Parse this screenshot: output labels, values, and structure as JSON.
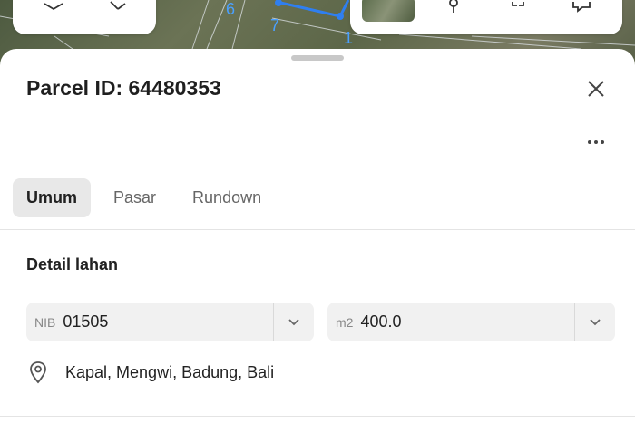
{
  "map": {
    "parcel_numbers": [
      "6",
      "7",
      "1"
    ],
    "accent_color": "#2f7ff0"
  },
  "toolbar_left": {
    "icons": [
      "layers-icon",
      "ruler-icon"
    ]
  },
  "toolbar_right": {
    "icons": [
      "satellite-thumbnail",
      "pin-icon",
      "split-icon",
      "chat-icon"
    ]
  },
  "sheet": {
    "title": "Parcel ID: 64480353",
    "tabs": [
      {
        "label": "Umum",
        "active": true
      },
      {
        "label": "Pasar",
        "active": false
      },
      {
        "label": "Rundown",
        "active": false
      }
    ],
    "section_title": "Detail lahan",
    "nib": {
      "prefix": "NIB",
      "value": "01505"
    },
    "area": {
      "prefix": "m2",
      "value": "400.0"
    },
    "location": "Kapal, Mengwi, Badung, Bali"
  }
}
